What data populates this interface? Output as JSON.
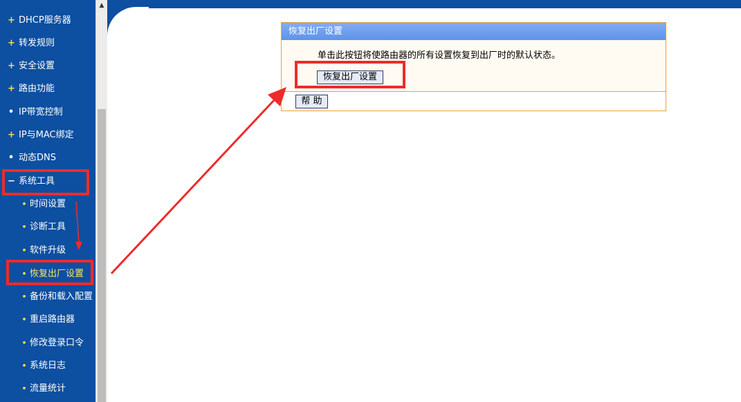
{
  "sidebar": {
    "items": [
      {
        "icon": "+",
        "label": "DHCP服务器"
      },
      {
        "icon": "+",
        "label": "转发规则"
      },
      {
        "icon": "+",
        "label": "安全设置"
      },
      {
        "icon": "+",
        "label": "路由功能"
      },
      {
        "icon": "•",
        "label": "IP带宽控制"
      },
      {
        "icon": "+",
        "label": "IP与MAC绑定"
      },
      {
        "icon": "•",
        "label": "动态DNS"
      },
      {
        "icon": "−",
        "label": "系统工具"
      }
    ],
    "subitems": [
      {
        "label": "时间设置"
      },
      {
        "label": "诊断工具"
      },
      {
        "label": "软件升级"
      },
      {
        "label": "恢复出厂设置"
      },
      {
        "label": "备份和载入配置"
      },
      {
        "label": "重启路由器"
      },
      {
        "label": "修改登录口令"
      },
      {
        "label": "系统日志"
      },
      {
        "label": "流量统计"
      }
    ],
    "selected": "恢复出厂设置"
  },
  "panel": {
    "title": "恢复出厂设置",
    "description": "单击此按钮将使路由器的所有设置恢复到出厂时的默认状态。",
    "restore_button": "恢复出厂设置",
    "help_button": "帮 助"
  },
  "icons": {
    "expand": "plus-icon",
    "collapse": "minus-icon",
    "bullet": "bullet-icon",
    "scroll_up": "triangle-up-icon"
  },
  "colors": {
    "sidebar_bg": "#0d4fa0",
    "panel_header": "#6e9ff0",
    "panel_border": "#f0a030",
    "annotation": "#ee2b2b",
    "selected_text": "#ffe45c"
  }
}
